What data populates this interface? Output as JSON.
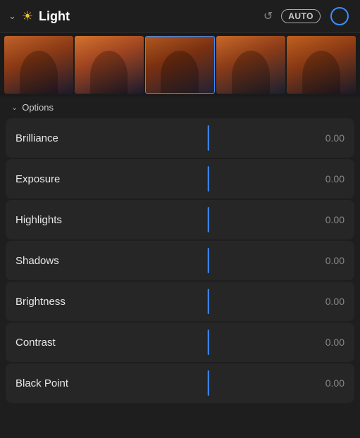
{
  "header": {
    "title": "Light",
    "auto_label": "AUTO",
    "undo_symbol": "↺"
  },
  "options": {
    "label": "Options"
  },
  "sliders": [
    {
      "label": "Brilliance",
      "value": "0.00"
    },
    {
      "label": "Exposure",
      "value": "0.00"
    },
    {
      "label": "Highlights",
      "value": "0.00"
    },
    {
      "label": "Shadows",
      "value": "0.00"
    },
    {
      "label": "Brightness",
      "value": "0.00"
    },
    {
      "label": "Contrast",
      "value": "0.00"
    },
    {
      "label": "Black Point",
      "value": "0.00"
    }
  ],
  "colors": {
    "accent": "#3a8eff",
    "bg": "#1e1e1e",
    "row_bg": "#262626"
  }
}
